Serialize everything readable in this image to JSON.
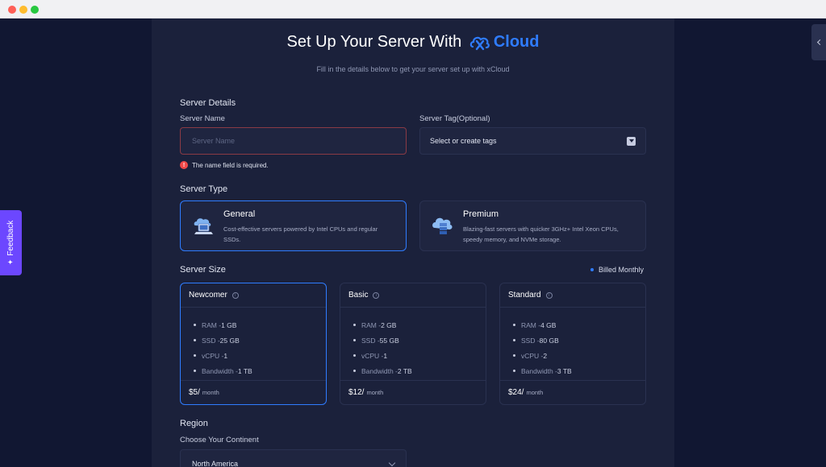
{
  "page": {
    "title_prefix": "Set Up Your Server With",
    "brand": "Cloud",
    "subtitle": "Fill in the details below to get your server set up with xCloud"
  },
  "server_details": {
    "section_label": "Server Details",
    "name_label": "Server Name",
    "name_placeholder": "Server Name",
    "name_value": "",
    "name_error": "The name field is required.",
    "tag_label": "Server Tag(Optional)",
    "tag_placeholder": "Select or create tags"
  },
  "server_type": {
    "section_label": "Server Type",
    "options": [
      {
        "title": "General",
        "description": "Cost-effective servers powered by Intel CPUs and regular SSDs.",
        "selected": true,
        "icon": "server-laptop-icon"
      },
      {
        "title": "Premium",
        "description": "Blazing-fast servers with quicker 3GHz+ Intel Xeon CPUs, speedy memory, and NVMe storage.",
        "selected": false,
        "icon": "cloud-server-icon"
      }
    ]
  },
  "server_size": {
    "section_label": "Server Size",
    "billing": "Billed Monthly",
    "per_label": "month",
    "plans": [
      {
        "name": "Newcomer",
        "selected": true,
        "ram": "1 GB",
        "ssd": "25 GB",
        "vcpu": "1",
        "bandwidth": "1 TB",
        "price": "$5/"
      },
      {
        "name": "Basic",
        "selected": false,
        "ram": "2 GB",
        "ssd": "55 GB",
        "vcpu": "1",
        "bandwidth": "2 TB",
        "price": "$12/"
      },
      {
        "name": "Standard",
        "selected": false,
        "ram": "4 GB",
        "ssd": "80 GB",
        "vcpu": "2",
        "bandwidth": "3 TB",
        "price": "$24/"
      }
    ],
    "spec_labels": {
      "ram": "RAM - ",
      "ssd": "SSD - ",
      "vcpu": "vCPU - ",
      "bandwidth": "Bandwidth - "
    }
  },
  "region": {
    "section_label": "Region",
    "continent_label": "Choose Your Continent",
    "continent_value": "North America"
  },
  "feedback": {
    "label": "Feedback"
  },
  "colors": {
    "accent": "#2f7cff",
    "error": "#f04848",
    "feedback": "#6c47ff",
    "panel": "#1b213b",
    "background": "#111732"
  }
}
